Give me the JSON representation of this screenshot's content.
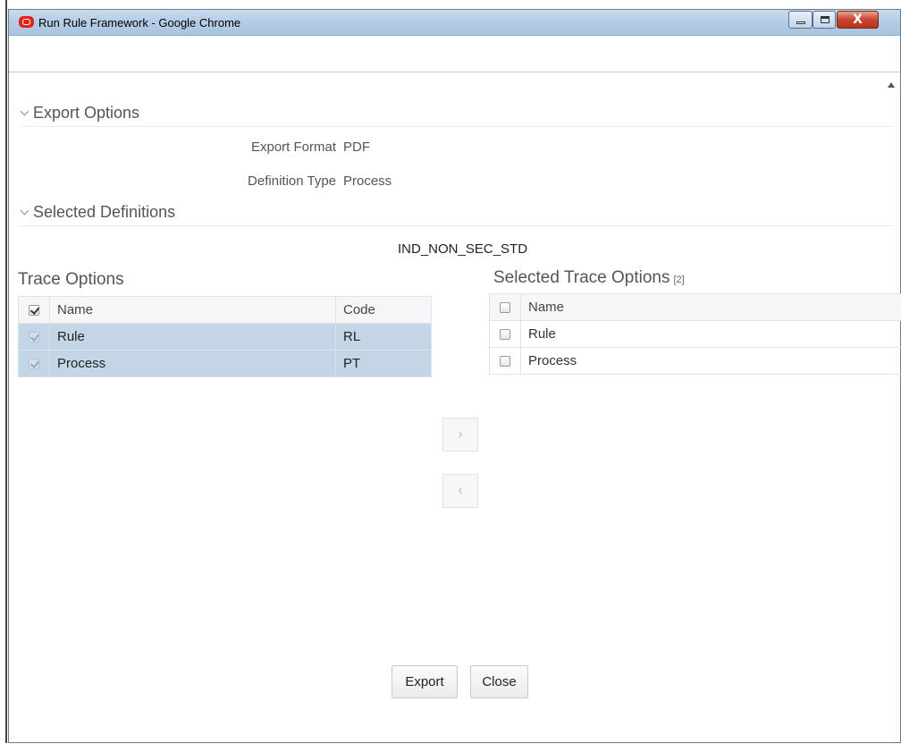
{
  "window": {
    "title": "Run Rule Framework - Google Chrome",
    "close_label": "X"
  },
  "export_options": {
    "header": "Export Options",
    "format_label": "Export Format",
    "format_value": "PDF",
    "def_type_label": "Definition Type",
    "def_type_value": "Process"
  },
  "selected_definitions": {
    "header": "Selected Definitions",
    "items": [
      "IND_NON_SEC_STD"
    ]
  },
  "trace_options": {
    "title": "Trace Options",
    "columns": [
      "Name",
      "Code"
    ],
    "rows": [
      {
        "name": "Rule",
        "code": "RL",
        "selected": true
      },
      {
        "name": "Process",
        "code": "PT",
        "selected": true
      }
    ]
  },
  "selected_trace_options": {
    "title": "Selected Trace Options",
    "count": "[2]",
    "columns": [
      "Name"
    ],
    "rows": [
      {
        "name": "Rule"
      },
      {
        "name": "Process"
      }
    ]
  },
  "move_buttons": {
    "move_right": "›",
    "move_left": "‹"
  },
  "actions": {
    "export": "Export",
    "close": "Close"
  }
}
